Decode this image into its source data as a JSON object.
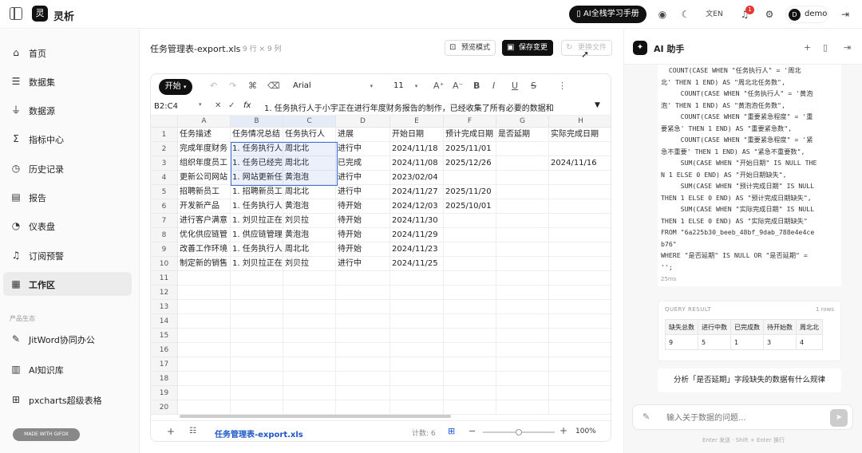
{
  "app": {
    "logo": "灵",
    "name": "灵析",
    "ai_course": "AI全栈学习手册",
    "lang": "EN",
    "notify_count": "1",
    "user_avatar": "D",
    "user_name": "demo"
  },
  "sidebar": {
    "items": [
      {
        "label": "首页",
        "icon": "home-icon"
      },
      {
        "label": "数据集",
        "icon": "database-icon"
      },
      {
        "label": "数据源",
        "icon": "plug-icon"
      },
      {
        "label": "指标中心",
        "icon": "sigma-icon"
      },
      {
        "label": "历史记录",
        "icon": "history-icon"
      },
      {
        "label": "报告",
        "icon": "report-icon"
      },
      {
        "label": "仪表盘",
        "icon": "dashboard-icon"
      },
      {
        "label": "订阅预警",
        "icon": "bell-icon"
      },
      {
        "label": "工作区",
        "icon": "grid-icon",
        "active": true
      }
    ],
    "section_label": "产品生态",
    "eco": [
      {
        "label": "JitWord协同办公",
        "icon": "edit-icon"
      },
      {
        "label": "AI知识库",
        "icon": "book-icon"
      },
      {
        "label": "pxcharts超级表格",
        "icon": "table-icon"
      }
    ],
    "badge": "MADE WITH GIFOX"
  },
  "file": {
    "name": "任务管理表-export.xls",
    "meta": "9 行 × 9 列",
    "preview_btn": "预览模式",
    "save_btn": "保存变更",
    "update_btn": "更换文件"
  },
  "toolbar": {
    "start": "开始",
    "font": "Arial",
    "size": "11"
  },
  "formula": {
    "cell_ref": "B2:C4",
    "fx": "fx",
    "value": "1. 任务执行人于小宇正在进行年度财务报告的制作，已经收集了所有必要的数据和"
  },
  "columns": [
    "A",
    "B",
    "C",
    "D",
    "E",
    "F",
    "G",
    "H"
  ],
  "rows": [
    [
      "任务描述",
      "任务情况总结",
      "任务执行人",
      "进展",
      "开始日期",
      "预计完成日期",
      "是否延期",
      "实际完成日期"
    ],
    [
      "完成年度财务",
      "1. 任务执行人",
      "周北北",
      "进行中",
      "2024/11/18",
      "2025/11/01",
      "",
      ""
    ],
    [
      "组织年度员工",
      "1. 任务已经完",
      "周北北",
      "已完成",
      "2024/11/08",
      "2025/12/26",
      "",
      "2024/11/16"
    ],
    [
      "更新公司网站",
      "1. 网站更新任",
      "黄泡泡",
      "进行中",
      "2023/02/04",
      "",
      "",
      ""
    ],
    [
      "招聘新员工",
      "1. 招聘新员工",
      "周北北",
      "进行中",
      "2024/11/27",
      "2025/11/20",
      "",
      ""
    ],
    [
      "开发新产品",
      "1. 任务执行人",
      "黄泡泡",
      "待开始",
      "2024/12/03",
      "2025/10/01",
      "",
      ""
    ],
    [
      "进行客户满意",
      "1. 刘贝拉正在",
      "刘贝拉",
      "待开始",
      "2024/11/30",
      "",
      "",
      ""
    ],
    [
      "优化供应链管",
      "1. 供应链管理",
      "黄泡泡",
      "待开始",
      "2024/11/29",
      "",
      "",
      ""
    ],
    [
      "改善工作环境",
      "1. 任务执行人",
      "周北北",
      "待开始",
      "2024/11/23",
      "",
      "",
      ""
    ],
    [
      "制定新的销售",
      "1. 刘贝拉正在",
      "刘贝拉",
      "进行中",
      "2024/11/25",
      "",
      "",
      ""
    ]
  ],
  "row_numbers": [
    "1",
    "2",
    "3",
    "4",
    "5",
    "6",
    "7",
    "8",
    "9",
    "10",
    "11",
    "12",
    "13",
    "14",
    "15",
    "16",
    "17",
    "18",
    "19",
    "20"
  ],
  "footer": {
    "tab": "任务管理表-export.xls",
    "count": "计数: 6",
    "zoom": "100%",
    "zoom_level": 0.5
  },
  "ai": {
    "title": "AI 助手",
    "code": "  COUNT(CASE WHEN \"任务执行人\" = '周北\n北' THEN 1 END) AS \"周北北任务数\",\n     COUNT(CASE WHEN \"任务执行人\" = '黄泡\n泡' THEN 1 END) AS \"黄泡泡任务数\",\n     COUNT(CASE WHEN \"重要紧急程度\" = '重\n要紧急' THEN 1 END) AS \"重要紧急数\",\n     COUNT(CASE WHEN \"重要紧急程度\" = '紧\n急不重要' THEN 1 END) AS \"紧急不重要数\",\n     SUM(CASE WHEN \"开始日期\" IS NULL THE\nN 1 ELSE 0 END) AS \"开始日期缺失\",\n     SUM(CASE WHEN \"预计完成日期\" IS NULL\nTHEN 1 ELSE 0 END) AS \"预计完成日期缺失\",\n     SUM(CASE WHEN \"实际完成日期\" IS NULL\nTHEN 1 ELSE 0 END) AS \"实际完成日期缺失\"\nFROM \"6a225b30_beeb_48bf_9dab_788e4e4ce\nb76\"\nWHERE \"是否延期\" IS NULL OR \"是否延期\" =\n'';",
    "duration": "25ms",
    "query_title": "QUERY RESULT",
    "query_rows": "1 rows",
    "query_headers": [
      "缺失总数",
      "进行中数",
      "已完成数",
      "待开始数",
      "周北北"
    ],
    "query_values": [
      "9",
      "5",
      "1",
      "3",
      "4"
    ],
    "suggestion": "分析「是否延期」字段缺失的数据有什么规律",
    "input_placeholder": "输入关于数据的问题...",
    "hint": "Enter 发送 · Shift + Enter 换行"
  }
}
